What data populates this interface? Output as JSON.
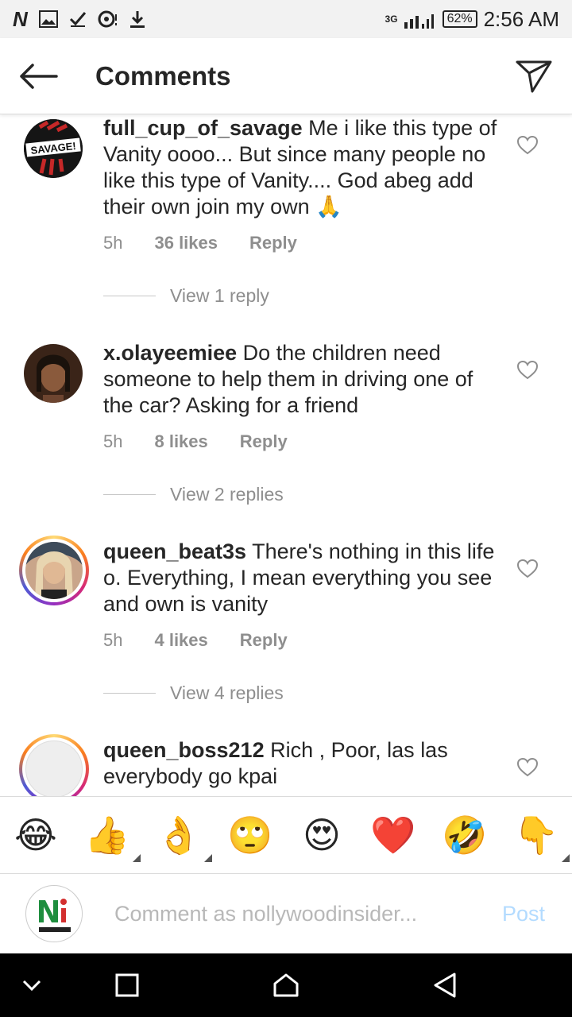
{
  "status_bar": {
    "left_icons": [
      "nollywood-n-icon",
      "image-icon",
      "check-icon",
      "whatsapp-icon",
      "download-icon"
    ],
    "n_label": "N",
    "network": "3G",
    "battery": "62%",
    "time": "2:56 AM"
  },
  "header": {
    "title": "Comments"
  },
  "comments": [
    {
      "username": "full_cup_of_savage",
      "text": "Me i like this type of Vanity oooo... But since many people no like this type of Vanity.... God abeg add their own join my own 🙏",
      "time": "5h",
      "likes": "36 likes",
      "reply": "Reply",
      "view_replies": "View 1 reply",
      "avatar_text": "SAVAGE!"
    },
    {
      "username": "x.olayeemiee",
      "text": "Do the children need someone to help them in driving one of the car? Asking for a friend",
      "time": "5h",
      "likes": "8 likes",
      "reply": "Reply",
      "view_replies": "View 2 replies"
    },
    {
      "username": "queen_beat3s",
      "text": "There's nothing in this life o. Everything, I mean everything you see and own is vanity",
      "time": "5h",
      "likes": "4 likes",
      "reply": "Reply",
      "view_replies": "View 4 replies"
    },
    {
      "username": "queen_boss212",
      "text": "Rich , Poor, las las everybody go kpai"
    }
  ],
  "emoji_bar": [
    "😂",
    "👍",
    "👌",
    "🙄",
    "😍",
    "❤️",
    "🤣",
    "👇"
  ],
  "input": {
    "placeholder": "Comment as nollywoodinsider...",
    "post_label": "Post"
  },
  "colors": {
    "text": "#262626",
    "meta": "#8e8e8e",
    "post_disabled": "#b3dbff",
    "heart_stroke": "#8e8e8e"
  }
}
